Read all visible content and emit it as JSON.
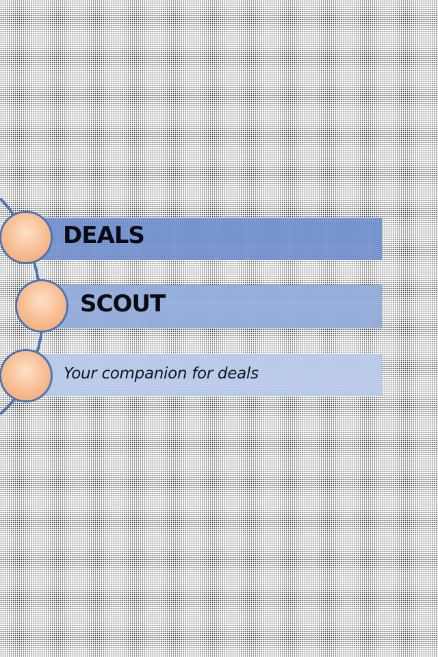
{
  "title_line_1": "DEALS",
  "title_line_2": "SCOUT",
  "tagline": "Your companion for deals",
  "colors": {
    "band_dark": "#6f8fcc",
    "band_mid": "#8fa9d8",
    "band_light": "#b6c8e8",
    "circle_fill": "#f8bf95",
    "circle_border": "#4e74b2"
  }
}
